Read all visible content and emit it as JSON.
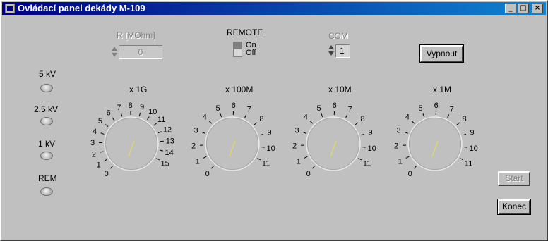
{
  "window": {
    "title": "Ovládací panel dekády M-109",
    "controls": [
      "_",
      "□",
      "×"
    ]
  },
  "header": {
    "resistance_label": "R [MOhm]",
    "resistance_value": "0",
    "remote_label": "REMOTE",
    "remote_on": "On",
    "remote_off": "Off",
    "com_label": "COM",
    "com_value": "1",
    "vypnout_label": "Vypnout"
  },
  "indicators": [
    {
      "label": "5 kV"
    },
    {
      "label": "2.5 kV"
    },
    {
      "label": "1 kV"
    },
    {
      "label": "REM"
    }
  ],
  "knobs": [
    {
      "title": "x 1G",
      "ticks": [
        "0",
        "1",
        "2",
        "3",
        "4",
        "5",
        "6",
        "7",
        "8",
        "9",
        "10",
        "11",
        "12",
        "13",
        "14",
        "15"
      ],
      "value": "0"
    },
    {
      "title": "x 100M",
      "ticks": [
        "0",
        "1",
        "2",
        "3",
        "4",
        "5",
        "6",
        "7",
        "8",
        "9",
        "10",
        "11"
      ],
      "value": "0"
    },
    {
      "title": "x 10M",
      "ticks": [
        "0",
        "1",
        "2",
        "3",
        "4",
        "5",
        "6",
        "7",
        "8",
        "9",
        "10",
        "11"
      ],
      "value": "0"
    },
    {
      "title": "x 1M",
      "ticks": [
        "0",
        "1",
        "2",
        "3",
        "4",
        "5",
        "6",
        "7",
        "8",
        "9",
        "10",
        "11"
      ],
      "value": "0"
    }
  ],
  "buttons": {
    "start_label": "Start",
    "konec_label": "Konec"
  },
  "colors": {
    "title_start": "#000080",
    "title_end": "#1084d0",
    "face": "#c0c0c0",
    "pointer": "#d8d870"
  }
}
